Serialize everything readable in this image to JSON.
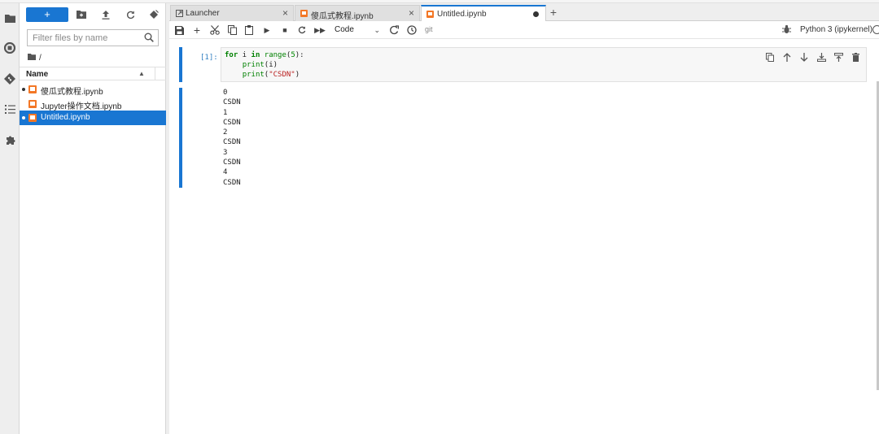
{
  "filebrowser": {
    "new_label": "+",
    "filter_placeholder": "Filter files by name",
    "breadcrumb": "/",
    "column_name": "Name",
    "files": [
      {
        "name": "傻瓜式教程.ipynb",
        "running": true,
        "selected": false
      },
      {
        "name": "Jupyter操作文档.ipynb",
        "running": false,
        "selected": false
      },
      {
        "name": "Untitled.ipynb",
        "running": true,
        "selected": true
      }
    ]
  },
  "tabs": [
    {
      "label": "Launcher",
      "icon": "launcher-icon"
    },
    {
      "label": "傻瓜式教程.ipynb",
      "icon": "notebook-icon"
    },
    {
      "label": "Untitled.ipynb",
      "icon": "notebook-icon",
      "active": true
    }
  ],
  "toolbar": {
    "cell_type": "Code",
    "git_label": "git",
    "kernel": "Python 3 (ipykernel)"
  },
  "cell": {
    "prompt": "[1]:",
    "code_lines": [
      "for i in range(5):",
      "    print(i)",
      "    print(\"CSDN\")"
    ],
    "output": "0\nCSDN\n1\nCSDN\n2\nCSDN\n3\nCSDN\n4\nCSDN"
  },
  "colors": {
    "accent": "#1976d2",
    "notebook_icon": "#f37726"
  }
}
